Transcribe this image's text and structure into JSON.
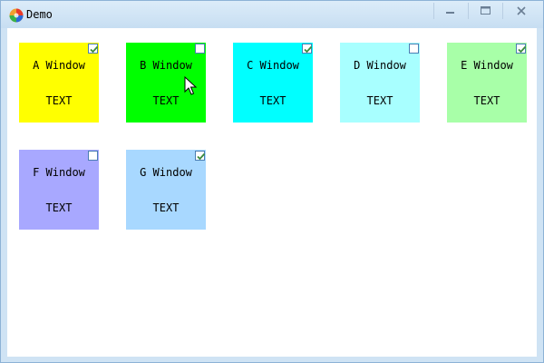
{
  "window": {
    "title": "Demo",
    "controls": {
      "minimize": "minimize-icon",
      "maximize": "maximize-icon",
      "close": "close-icon"
    }
  },
  "tiles": [
    {
      "title": "A Window",
      "text": "TEXT",
      "color": "#ffff00",
      "checked": true
    },
    {
      "title": "B Window",
      "text": "TEXT",
      "color": "#00ff00",
      "checked": false
    },
    {
      "title": "C Window",
      "text": "TEXT",
      "color": "#00ffff",
      "checked": true
    },
    {
      "title": "D Window",
      "text": "TEXT",
      "color": "#a8ffff",
      "checked": false
    },
    {
      "title": "E Window",
      "text": "TEXT",
      "color": "#a8ffa8",
      "checked": true
    },
    {
      "title": "F Window",
      "text": "TEXT",
      "color": "#a8a8ff",
      "checked": false
    },
    {
      "title": "G Window",
      "text": "TEXT",
      "color": "#a8d8ff",
      "checked": true
    }
  ],
  "colors": {
    "titlebar": "#cfe3f4",
    "checkbox_border": "#4a7db3",
    "checkmark": "#3a8a3a"
  }
}
